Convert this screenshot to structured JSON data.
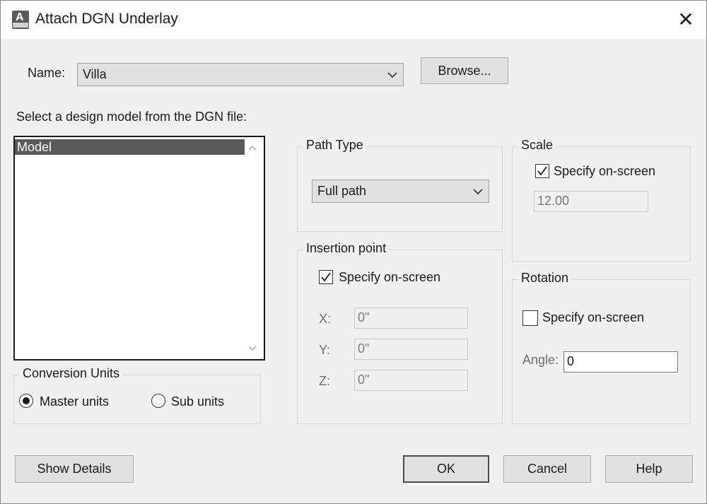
{
  "window": {
    "title": "Attach DGN Underlay",
    "icon": "autocad-app-icon",
    "icon_letter": "A",
    "close_glyph": "✕"
  },
  "name_row": {
    "label": "Name:",
    "value": "Villa",
    "browse_label": "Browse..."
  },
  "model_list": {
    "label": "Select a design model from the DGN file:",
    "items": [
      "Model"
    ],
    "selected_index": 0
  },
  "conversion_units": {
    "title": "Conversion Units",
    "options": [
      "Master units",
      "Sub units"
    ],
    "selected": "Master units"
  },
  "path_type": {
    "title": "Path Type",
    "value": "Full path"
  },
  "scale": {
    "title": "Scale",
    "specify_label": "Specify on-screen",
    "specify_checked": true,
    "value": "12.00"
  },
  "insertion_point": {
    "title": "Insertion point",
    "specify_label": "Specify on-screen",
    "specify_checked": true,
    "x_label": "X:",
    "x_value": "0\"",
    "y_label": "Y:",
    "y_value": "0\"",
    "z_label": "Z:",
    "z_value": "0\""
  },
  "rotation": {
    "title": "Rotation",
    "specify_label": "Specify on-screen",
    "specify_checked": false,
    "angle_label": "Angle:",
    "angle_value": "0"
  },
  "buttons": {
    "show_details": "Show Details",
    "ok": "OK",
    "cancel": "Cancel",
    "help": "Help"
  },
  "colors": {
    "dialog_bg": "#f0f0f0",
    "selection": "#5a5a5a",
    "button_bg": "#e1e1e1"
  }
}
